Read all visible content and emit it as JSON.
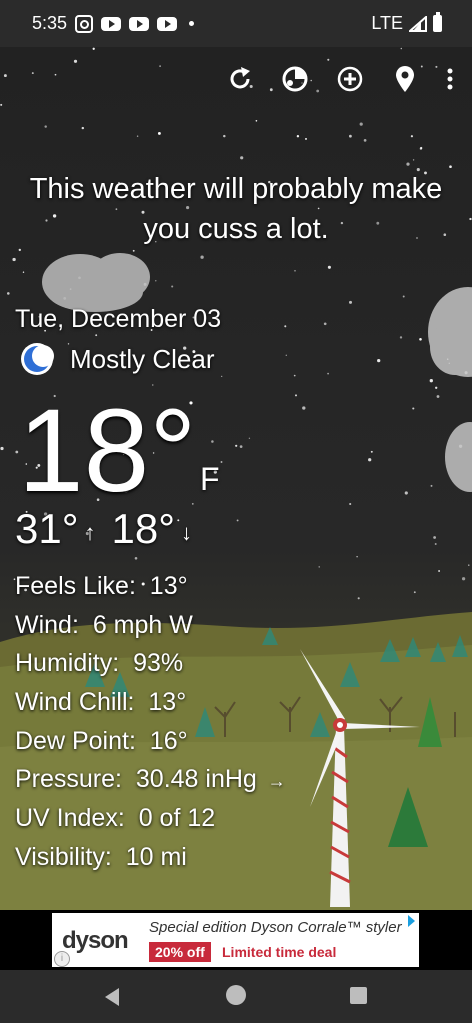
{
  "status_bar": {
    "time": "5:35",
    "network": "LTE"
  },
  "toolbar": {
    "refresh_icon": "refresh-icon",
    "radar_icon": "radar-icon",
    "add_icon": "add-circle-icon",
    "location_icon": "location-pin-icon",
    "menu_icon": "more-vert-icon"
  },
  "headline": "This weather will probably make you cuss a lot.",
  "current": {
    "date": "Tue, December 03",
    "condition": "Mostly Clear",
    "temperature": "18°",
    "unit": "F",
    "high": "31°",
    "low": "18°"
  },
  "details": [
    {
      "label": "Feels Like:",
      "value": "13°"
    },
    {
      "label": "Wind:",
      "value": "6 mph W"
    },
    {
      "label": "Humidity:",
      "value": "93%"
    },
    {
      "label": "Wind Chill:",
      "value": "13°"
    },
    {
      "label": "Dew Point:",
      "value": "16°"
    },
    {
      "label": "Pressure:",
      "value": "30.48 inHg"
    },
    {
      "label": "UV Index:",
      "value": "0 of 12"
    },
    {
      "label": "Visibility:",
      "value": "10 mi"
    }
  ],
  "ad": {
    "brand": "dyson",
    "headline": "Special edition Dyson Corrale™ styler",
    "badge": "20% off",
    "deal": "Limited time deal"
  },
  "colors": {
    "ad_red": "#c82a3b",
    "moon_blue": "#2f6fd6"
  }
}
